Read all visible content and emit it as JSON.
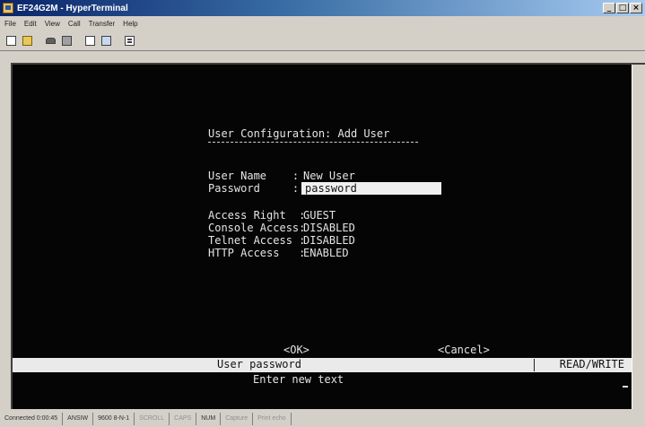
{
  "window": {
    "title": "EF24G2M - HyperTerminal",
    "controls": {
      "minimize": "_",
      "maximize": "□",
      "close": "×"
    }
  },
  "menu": {
    "items": [
      "File",
      "Edit",
      "View",
      "Call",
      "Transfer",
      "Help"
    ]
  },
  "toolbar": {
    "buttons": [
      {
        "icon": "new-icon"
      },
      {
        "icon": "open-icon"
      },
      {
        "icon": "connect-icon"
      },
      {
        "icon": "disconnect-icon"
      },
      {
        "icon": "send-icon"
      },
      {
        "icon": "receive-icon"
      },
      {
        "icon": "properties-icon"
      }
    ]
  },
  "terminal": {
    "heading": "User Configuration: Add User",
    "fields": [
      {
        "label": "User Name    :",
        "value": "New User"
      },
      {
        "label": "Password     :",
        "value": "password"
      }
    ],
    "access": [
      {
        "label": "Access Right  :",
        "value": "GUEST"
      },
      {
        "label": "Console Access:",
        "value": "DISABLED"
      },
      {
        "label": "Telnet Access :",
        "value": "DISABLED"
      },
      {
        "label": "HTTP Access   :",
        "value": "ENABLED"
      }
    ],
    "ok_label": "<OK>",
    "cancel_label": "<Cancel>",
    "status_field_label": "User password",
    "status_mode": "READ/WRITE",
    "hint": "Enter new text"
  },
  "status_bar": {
    "cells": [
      "Connected 0:00:45",
      "ANSIW",
      "9600 8-N-1",
      "SCROLL",
      "CAPS",
      "NUM",
      "Capture",
      "Print echo"
    ]
  },
  "colors": {
    "terminal_bg": "#050505",
    "terminal_fg": "#e4e4e4",
    "title_bar": "#0a246a",
    "chrome": "#d4d0c8"
  }
}
